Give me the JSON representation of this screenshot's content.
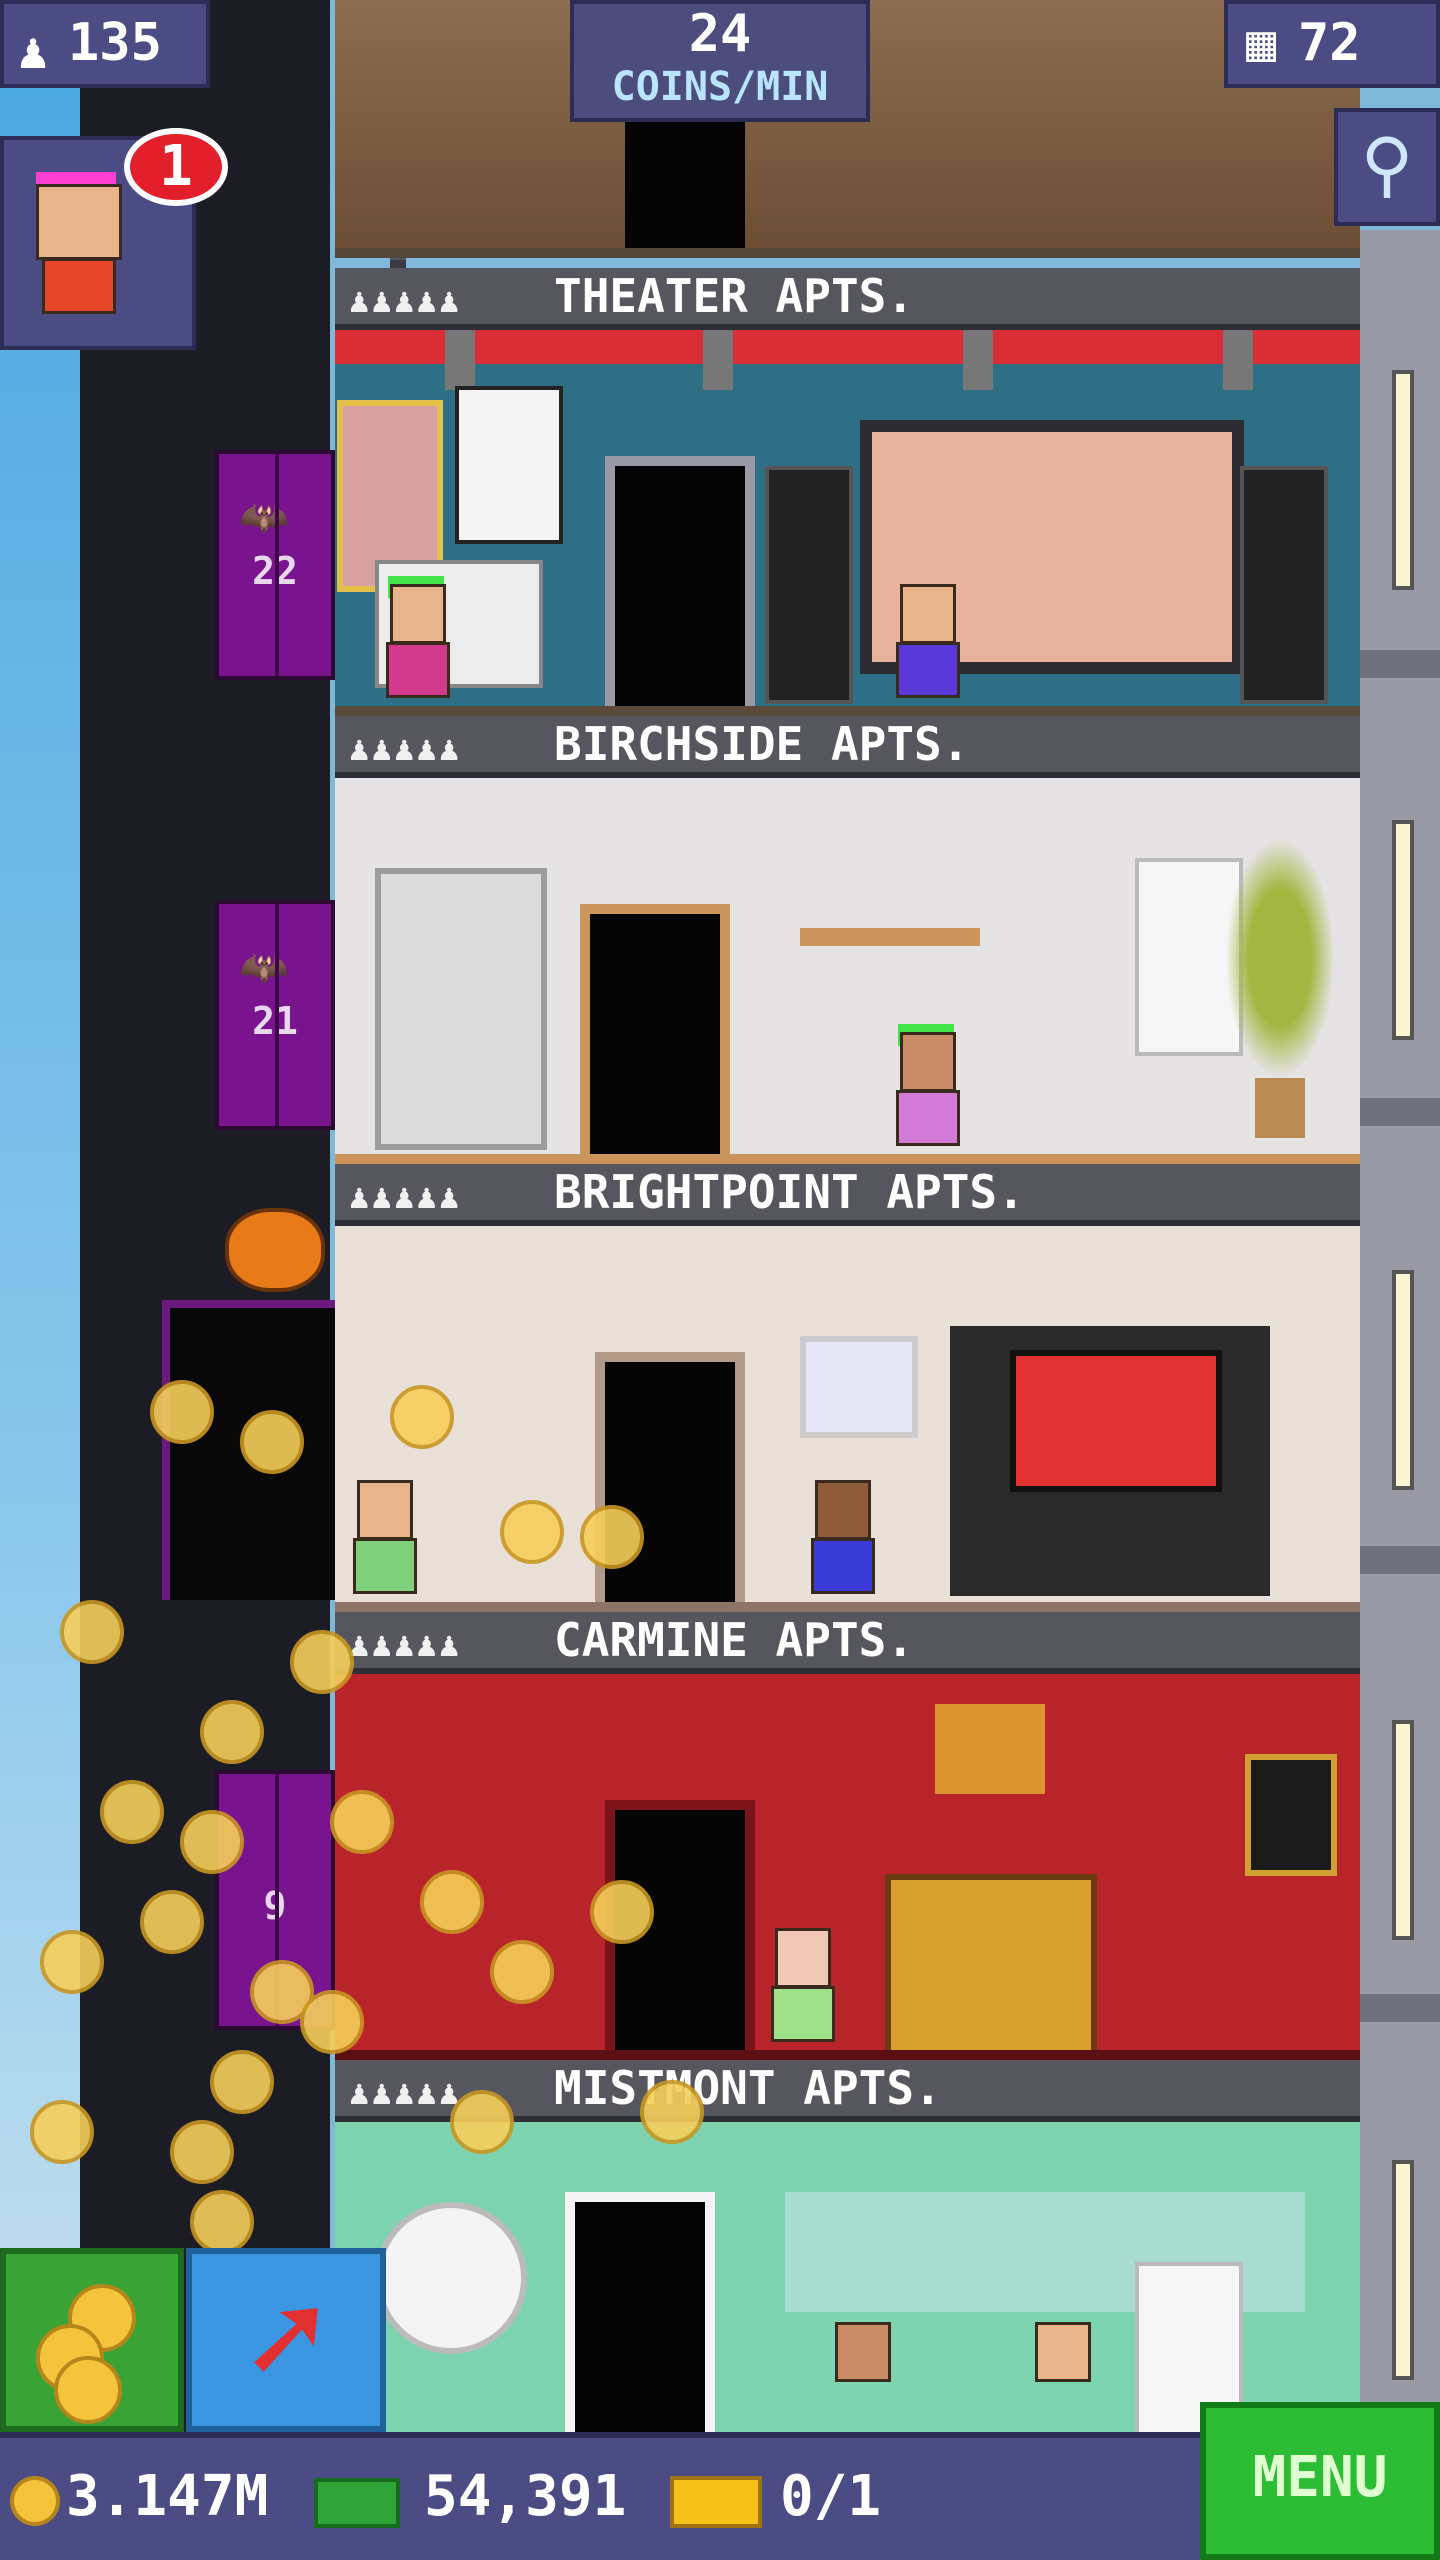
{
  "hud": {
    "population": "135",
    "coins_per_min_value": "24",
    "coins_per_min_label": "COINS/MIN",
    "floor_count": "72",
    "notification_count": "1"
  },
  "elevator": {
    "floor_numbers": [
      "22",
      "21",
      "9"
    ]
  },
  "floors": [
    {
      "name": "THEATER APTS.",
      "residents_icon": "♟♟♟♟♟"
    },
    {
      "name": "BIRCHSIDE APTS.",
      "residents_icon": "♟♟♟♟♟"
    },
    {
      "name": "BRIGHTPOINT APTS.",
      "residents_icon": "♟♟♟♟♟"
    },
    {
      "name": "CARMINE APTS.",
      "residents_icon": "♟♟♟♟♟"
    },
    {
      "name": "MISTMONT APTS.",
      "residents_icon": "♟♟♟♟♟"
    }
  ],
  "bottom_bar": {
    "coins": "3.147M",
    "bux": "54,391",
    "tickets": "0/1",
    "menu_label": "MENU"
  },
  "icons": {
    "population": "person-icon",
    "floors": "building-icon",
    "zoom": "magnifier-icon",
    "coins": "coin-icon",
    "bux": "bux-icon",
    "tickets": "ticket-icon",
    "arrow": "arrow-up-right-icon"
  },
  "colors": {
    "hud_bg": "#4c4c84",
    "coins_min_label": "#b9e6ff",
    "menu_green": "#2dbd34",
    "badge_red": "#e21f2a",
    "elevator_purple": "#7a148e"
  }
}
